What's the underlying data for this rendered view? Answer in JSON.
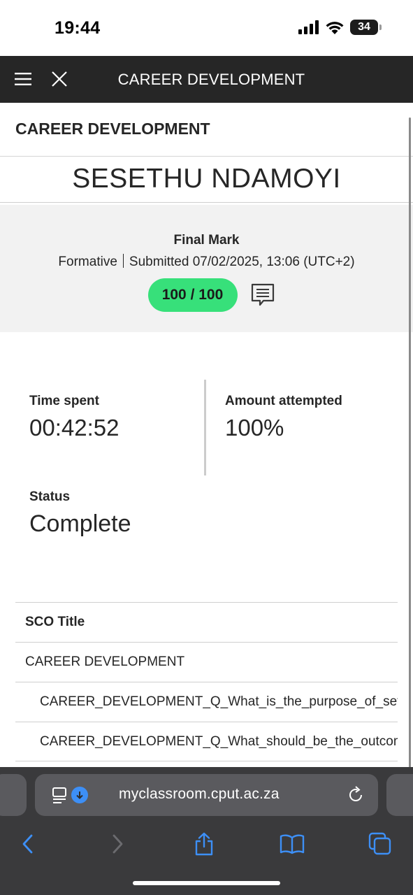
{
  "status_bar": {
    "time": "19:44",
    "battery": "34"
  },
  "app_bar": {
    "title": "CAREER DEVELOPMENT",
    "menu_icon": "hamburger-icon",
    "close_icon": "close-icon"
  },
  "course": {
    "header": "CAREER DEVELOPMENT"
  },
  "student": {
    "name": "SESETHU NDAMOYI"
  },
  "grade": {
    "label": "Final Mark",
    "type": "Formative",
    "submitted": "Submitted 07/02/2025, 13:06 (UTC+2)",
    "score": "100 / 100",
    "score_color": "#37e07a",
    "feedback_icon": "feedback-icon"
  },
  "stats": {
    "time_spent_label": "Time spent",
    "time_spent_value": "00:42:52",
    "amount_label": "Amount attempted",
    "amount_value": "100%",
    "status_label": "Status",
    "status_value": "Complete"
  },
  "sco_table": {
    "header": "SCO Title",
    "rows": [
      {
        "title": "CAREER DEVELOPMENT"
      },
      {
        "title": "CAREER_DEVELOPMENT_Q_What_is_the_purpose_of_setti"
      },
      {
        "title": "CAREER_DEVELOPMENT_Q_What_should_be_the_outcome"
      }
    ]
  },
  "browser": {
    "url": "myclassroom.cput.ac.za",
    "accent_color": "#3d8ff6",
    "toolbar_icons": [
      "back-icon",
      "forward-icon",
      "share-icon",
      "bookmarks-icon",
      "tabs-icon"
    ]
  }
}
